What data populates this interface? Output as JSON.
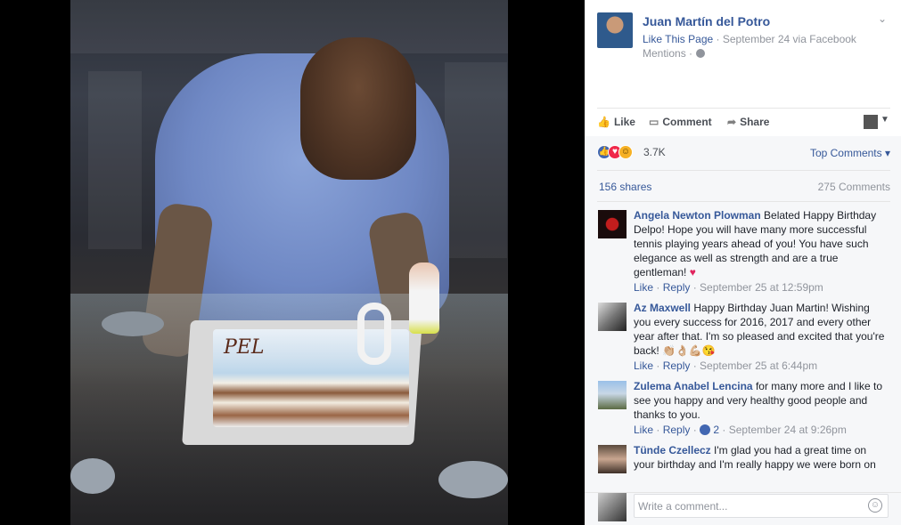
{
  "post": {
    "page_name": "Juan Martín del Potro",
    "like_page": "Like This Page",
    "date_via": "· September 24 via Facebook",
    "mentions": "Mentions ·"
  },
  "actions": {
    "like": "Like",
    "comment": "Comment",
    "share": "Share"
  },
  "summary": {
    "reaction_count": "3.7K",
    "sort_label": "Top Comments ▾",
    "shares": "156 shares",
    "comments_count": "275 Comments"
  },
  "comments": [
    {
      "author": "Angela Newton Plowman",
      "text": "Belated Happy Birthday Delpo! Hope you will have many more successful tennis playing years ahead of you! You have such elegance as well as strength and are a true gentleman!",
      "emoji": "♥",
      "like": "Like",
      "reply": "Reply",
      "time": "· September 25 at 12:59pm"
    },
    {
      "author": "Az Maxwell",
      "text": "Happy Birthday Juan Martin! Wishing you every success for 2016, 2017 and every other year after that. I'm so pleased and excited that you're back!",
      "emoji": "👏🏼👌🏼💪🏼😘",
      "like": "Like",
      "reply": "Reply",
      "time": "· September 25 at 6:44pm"
    },
    {
      "author": "Zulema Anabel Lencina",
      "text": "for many more and I like to see you happy and very healthy good people and thanks to you.",
      "like": "Like",
      "reply": "Reply",
      "like_count": "2",
      "time": "· September 24 at 9:26pm"
    },
    {
      "author": "Tünde Czellecz",
      "text": "I'm glad you had a great time on your birthday and I'm really happy we were born on"
    }
  ],
  "composer": {
    "placeholder": "Write a comment..."
  },
  "photo": {
    "cake_text": "PEL"
  },
  "colors": {
    "link": "#365899",
    "muted": "#90949c",
    "like_blue": "#4267b2",
    "love_red": "#f0284a",
    "haha_yellow": "#f7b125"
  }
}
